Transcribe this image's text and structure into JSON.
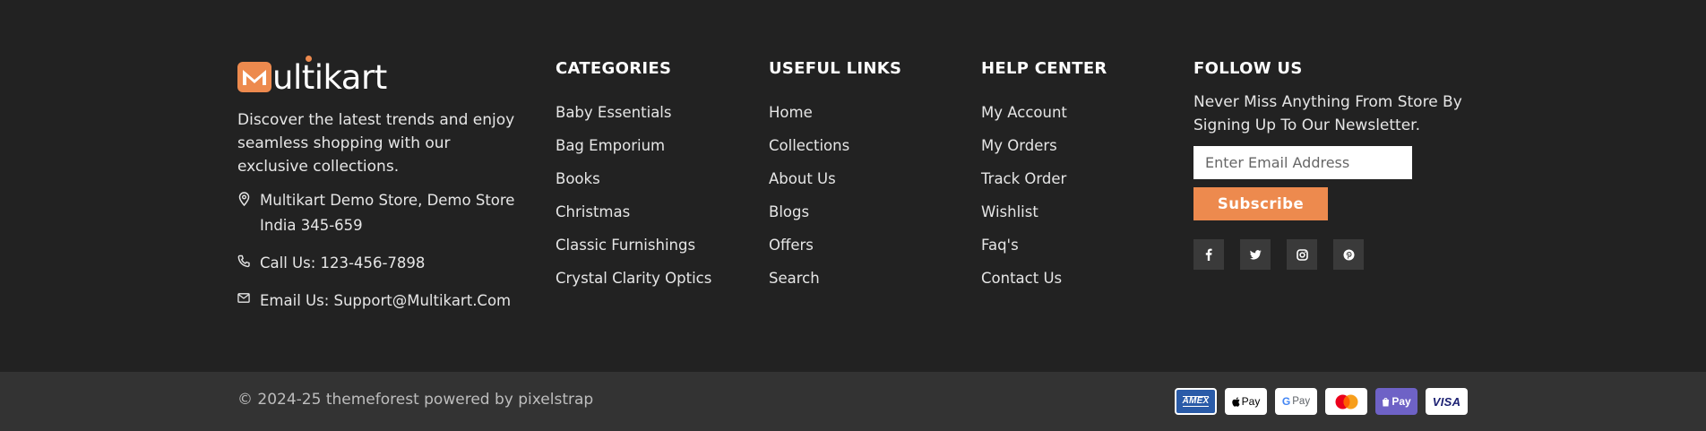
{
  "brand": {
    "logo_text_prefix": "ul",
    "logo_text_dot_letter": "t",
    "logo_text_suffix": "ikart",
    "logo_mark": "M",
    "accent_color": "#ed8a4e"
  },
  "about": {
    "description": "Discover the latest trends and enjoy seamless shopping with our exclusive collections.",
    "address": "Multikart Demo Store, Demo Store India 345-659",
    "phone": "Call Us: 123-456-7898",
    "email": "Email Us: Support@Multikart.Com",
    "icons": [
      "map-pin-icon",
      "phone-icon",
      "mail-icon"
    ]
  },
  "categories": {
    "heading": "CATEGORIES",
    "items": [
      "Baby Essentials",
      "Bag Emporium",
      "Books",
      "Christmas",
      "Classic Furnishings",
      "Crystal Clarity Optics"
    ]
  },
  "useful_links": {
    "heading": "USEFUL LINKS",
    "items": [
      "Home",
      "Collections",
      "About Us",
      "Blogs",
      "Offers",
      "Search"
    ]
  },
  "help_center": {
    "heading": "HELP CENTER",
    "items": [
      "My Account",
      "My Orders",
      "Track Order",
      "Wishlist",
      "Faq's",
      "Contact Us"
    ]
  },
  "follow_us": {
    "heading": "FOLLOW US",
    "newsletter_text": "Never Miss Anything From Store By Signing Up To Our Newsletter.",
    "email_placeholder": "Enter Email Address",
    "subscribe_label": "Subscribe",
    "socials": [
      "facebook-icon",
      "twitter-icon",
      "instagram-icon",
      "pinterest-icon"
    ]
  },
  "bottom": {
    "copyright": "© 2024-25 themeforest powered by pixelstrap",
    "payments": {
      "amex": "AMEX",
      "apple_pay": "Pay",
      "google_pay": "Pay",
      "shop_pay": "Pay",
      "visa": "VISA"
    }
  }
}
